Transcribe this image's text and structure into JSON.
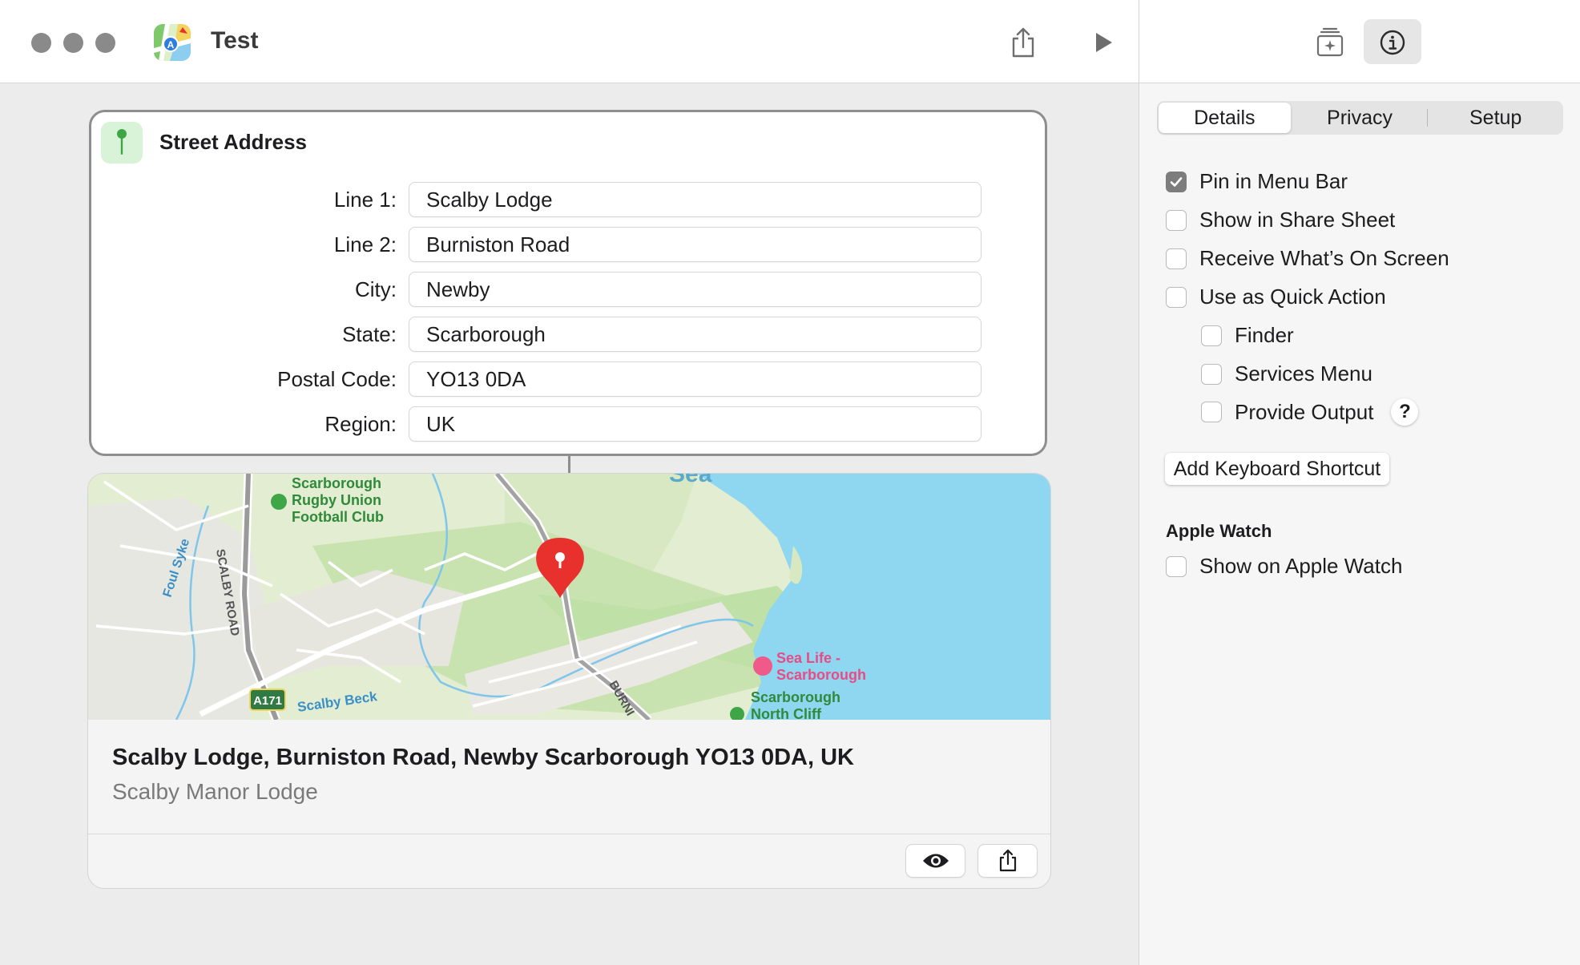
{
  "window": {
    "title": "Test",
    "app_icon": "maps-app-icon",
    "toolbar": {
      "share_icon": "share-icon",
      "run_icon": "play-icon"
    }
  },
  "sidebar": {
    "toolbar": {
      "library_icon": "add-to-library-icon",
      "info_icon": "info-icon"
    },
    "tabs": [
      {
        "label": "Details",
        "active": true
      },
      {
        "label": "Privacy",
        "active": false
      },
      {
        "label": "Setup",
        "active": false
      }
    ],
    "options": [
      {
        "label": "Pin in Menu Bar",
        "checked": true
      },
      {
        "label": "Show in Share Sheet",
        "checked": false
      },
      {
        "label": "Receive What’s On Screen",
        "checked": false
      },
      {
        "label": "Use as Quick Action",
        "checked": false
      }
    ],
    "quick_action_options": [
      {
        "label": "Finder",
        "checked": false
      },
      {
        "label": "Services Menu",
        "checked": false
      },
      {
        "label": "Provide Output",
        "checked": false
      }
    ],
    "help_label": "?",
    "keyboard_shortcut_button": "Add Keyboard Shortcut",
    "apple_watch": {
      "heading": "Apple Watch",
      "option": {
        "label": "Show on Apple Watch",
        "checked": false
      }
    }
  },
  "address_card": {
    "icon": "location-pin-icon",
    "title": "Street Address",
    "fields": [
      {
        "label": "Line 1:",
        "value": "Scalby Lodge"
      },
      {
        "label": "Line 2:",
        "value": "Burniston Road"
      },
      {
        "label": "City:",
        "value": "Newby"
      },
      {
        "label": "State:",
        "value": "Scarborough"
      },
      {
        "label": "Postal Code:",
        "value": "YO13 0DA"
      },
      {
        "label": "Region:",
        "value": "UK"
      }
    ]
  },
  "result": {
    "map": {
      "labels": {
        "rugby_club": [
          "Scarborough",
          "Rugby Union",
          "Football Club"
        ],
        "foul_syke": "Foul Syke",
        "scalby_road": "SCALBY ROAD",
        "road_number": "A171",
        "scalby_beck": "Scalby Beck",
        "burniston": "BURNI",
        "sea": "Sea",
        "sea_life": [
          "Sea Life -",
          "Scarborough"
        ],
        "north_cliff": [
          "Scarborough",
          "North Cliff"
        ]
      },
      "colors": {
        "land": "#e3edd2",
        "water": "#8fd6f1",
        "park": "#bfe0a6",
        "pin": "#e8302d"
      }
    },
    "title": "Scalby Lodge, Burniston Road, Newby Scarborough YO13 0DA, UK",
    "subtitle": "Scalby Manor Lodge",
    "buttons": {
      "quick_look_icon": "eye-icon",
      "share_icon": "share-icon"
    }
  }
}
